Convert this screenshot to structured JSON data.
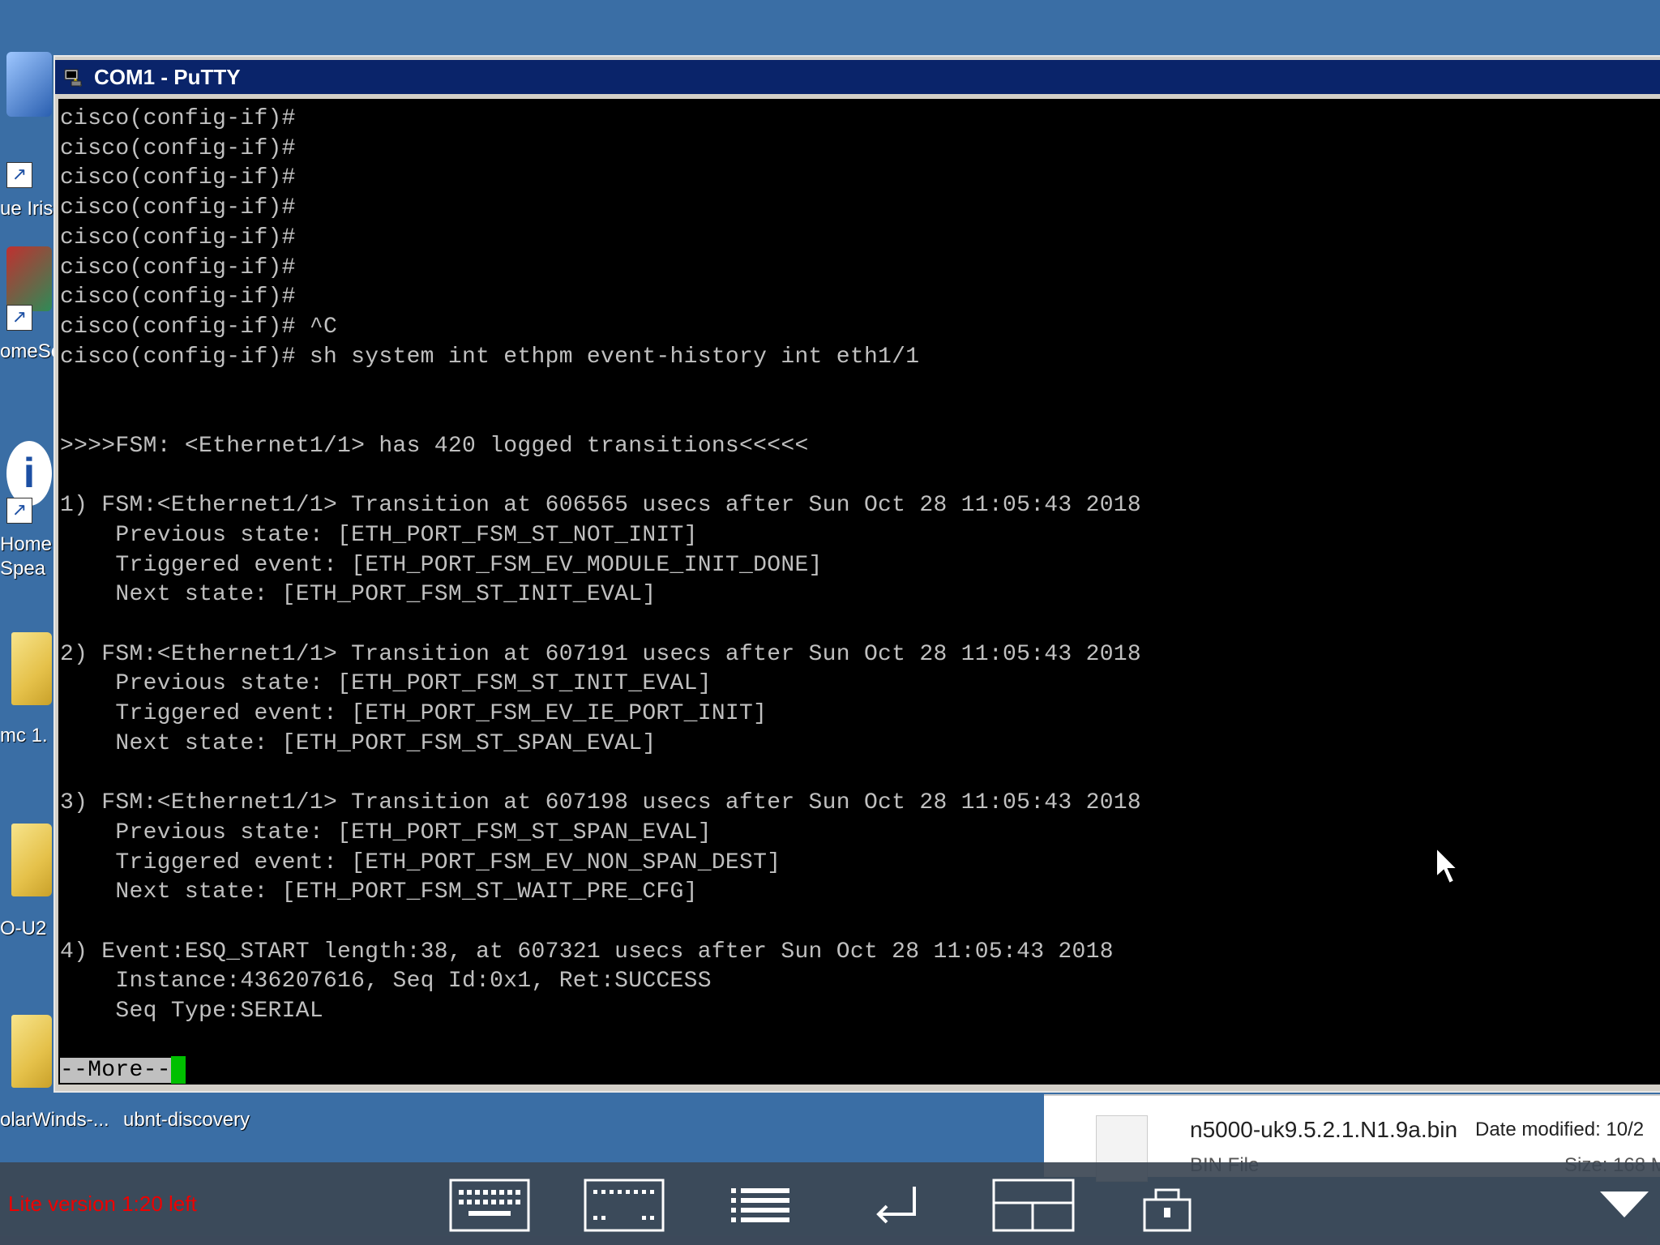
{
  "window": {
    "title": "COM1 - PuTTY",
    "terminal_lines": [
      "cisco(config-if)#",
      "cisco(config-if)#",
      "cisco(config-if)#",
      "cisco(config-if)#",
      "cisco(config-if)#",
      "cisco(config-if)#",
      "cisco(config-if)#",
      "cisco(config-if)# ^C",
      "cisco(config-if)# sh system int ethpm event-history int eth1/1",
      "",
      "",
      ">>>>FSM: <Ethernet1/1> has 420 logged transitions<<<<<",
      "",
      "1) FSM:<Ethernet1/1> Transition at 606565 usecs after Sun Oct 28 11:05:43 2018",
      "    Previous state: [ETH_PORT_FSM_ST_NOT_INIT]",
      "    Triggered event: [ETH_PORT_FSM_EV_MODULE_INIT_DONE]",
      "    Next state: [ETH_PORT_FSM_ST_INIT_EVAL]",
      "",
      "2) FSM:<Ethernet1/1> Transition at 607191 usecs after Sun Oct 28 11:05:43 2018",
      "    Previous state: [ETH_PORT_FSM_ST_INIT_EVAL]",
      "    Triggered event: [ETH_PORT_FSM_EV_IE_PORT_INIT]",
      "    Next state: [ETH_PORT_FSM_ST_SPAN_EVAL]",
      "",
      "3) FSM:<Ethernet1/1> Transition at 607198 usecs after Sun Oct 28 11:05:43 2018",
      "    Previous state: [ETH_PORT_FSM_ST_SPAN_EVAL]",
      "    Triggered event: [ETH_PORT_FSM_EV_NON_SPAN_DEST]",
      "    Next state: [ETH_PORT_FSM_ST_WAIT_PRE_CFG]",
      "",
      "4) Event:ESQ_START length:38, at 607321 usecs after Sun Oct 28 11:05:43 2018",
      "    Instance:436207616, Seq Id:0x1, Ret:SUCCESS",
      "    Seq Type:SERIAL",
      ""
    ],
    "more_prompt": "--More--"
  },
  "desktop": {
    "icon_labels": [
      "ue Iris",
      "omeSe",
      "Home",
      "Spea",
      "mc 1.",
      "O-U2"
    ],
    "bottom_labels": [
      "olarWinds-...",
      "ubnt-discovery"
    ]
  },
  "explorer": {
    "file_name": "n5000-uk9.5.2.1.N1.9a.bin",
    "date_modified": "Date modified: 10/2",
    "file_type": "BIN File",
    "size": "Size: 168 M"
  },
  "toolbar": {
    "lite_text": "Lite version 1:20 left",
    "icons": [
      "keyboard-icon",
      "function-keys-icon",
      "menu-list-icon",
      "enter-icon",
      "layout-icon",
      "lock-icon",
      "collapse-icon"
    ]
  },
  "colors": {
    "desktop_bg": "#3a6ea5",
    "terminal_bg": "#000000",
    "terminal_fg": "#c0c0c0",
    "cursor": "#00c000",
    "titlebar": "#0a246a",
    "lite_text": "#ee0000"
  }
}
